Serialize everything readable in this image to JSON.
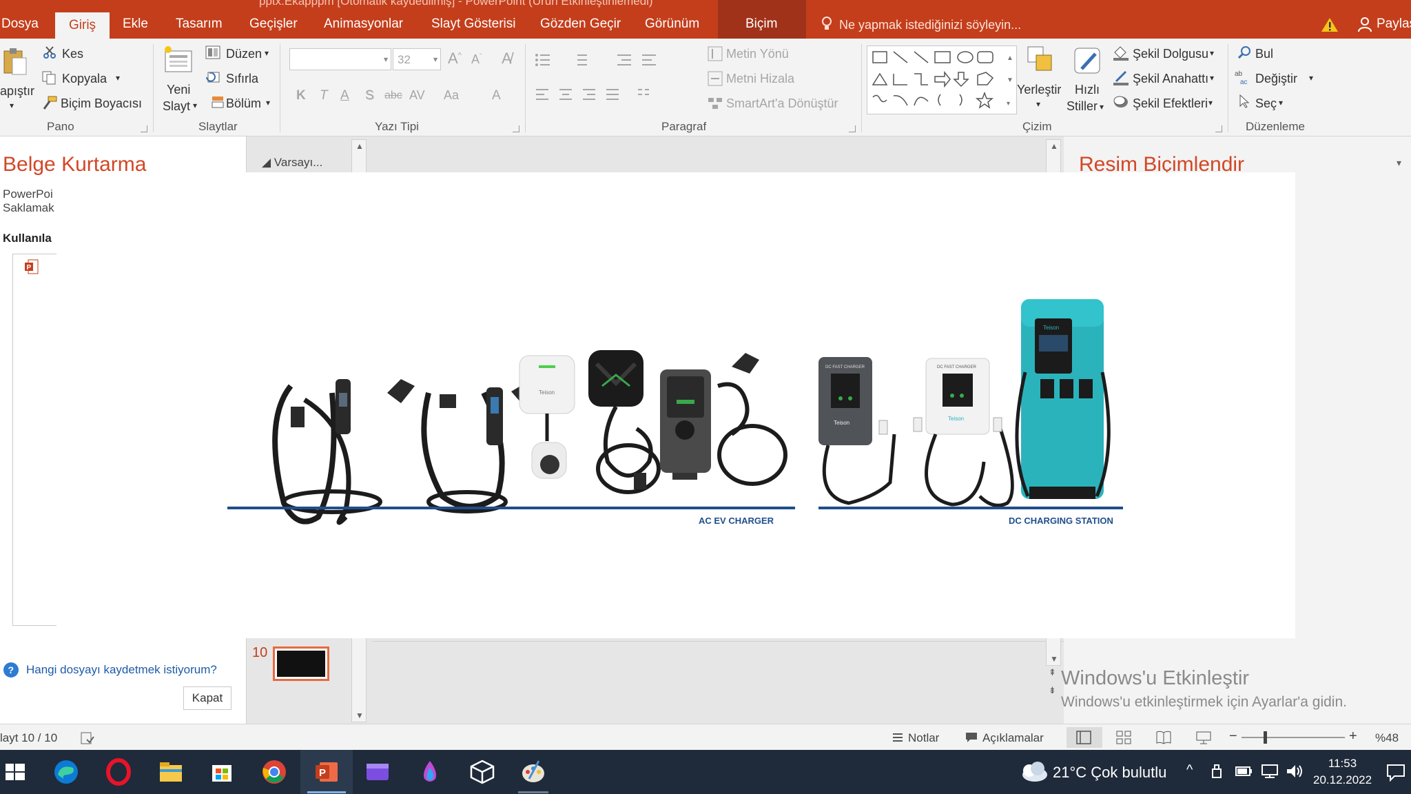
{
  "window": {
    "title_fragment": "pptx.Ekapppm [Otomatik kaydedilmiş] - PowerPoint (Ürün Etkinleştirilemedi)"
  },
  "tabs": [
    {
      "label": "Dosya"
    },
    {
      "label": "Giriş"
    },
    {
      "label": "Ekle"
    },
    {
      "label": "Tasarım"
    },
    {
      "label": "Geçişler"
    },
    {
      "label": "Animasyonlar"
    },
    {
      "label": "Slayt Gösterisi"
    },
    {
      "label": "Gözden Geçir"
    },
    {
      "label": "Görünüm"
    },
    {
      "label": "Biçim"
    }
  ],
  "tell_me": "Ne yapmak istediğinizi söyleyin...",
  "share": "Paylaş",
  "ribbon": {
    "clipboard": {
      "paste": "apıştır",
      "cut": "Kes",
      "copy": "Kopyala",
      "format_painter": "Biçim Boyacısı",
      "group": "Pano"
    },
    "slides": {
      "new_slide_line1": "Yeni",
      "new_slide_line2": "Slayt",
      "layout": "Düzen",
      "reset": "Sıfırla",
      "section": "Bölüm",
      "group": "Slaytlar"
    },
    "font": {
      "font_name": "",
      "font_size": "32",
      "group": "Yazı Tipi",
      "bold": "K",
      "italic": "T",
      "underline": "A",
      "shadow": "S",
      "strike": "abc",
      "spacing": "AV",
      "case": "Aa",
      "color": "A"
    },
    "paragraph": {
      "text_direction": "Metin Yönü",
      "align_text": "Metni Hizala",
      "smartart": "SmartArt'a Dönüştür",
      "group": "Paragraf"
    },
    "drawing": {
      "arrange": "Yerleştir",
      "quick_styles_line1": "Hızlı",
      "quick_styles_line2": "Stiller",
      "shape_fill": "Şekil Dolgusu",
      "shape_outline": "Şekil Anahattı",
      "shape_effects": "Şekil Efektleri",
      "group": "Çizim"
    },
    "editing": {
      "find": "Bul",
      "replace": "Değiştir",
      "select": "Seç",
      "group": "Düzenleme"
    }
  },
  "recovery_pane": {
    "title": "Belge Kurtarma",
    "desc_line1": "PowerPoi",
    "desc_line2": "Saklamak",
    "available": "Kullanıla",
    "help_link": "Hangi dosyayı kaydetmek istiyorum?",
    "close_button": "Kapat"
  },
  "thumbnail_pane": {
    "section": "Varsayı...",
    "slide_number": "10"
  },
  "format_pane": {
    "title": "Resim Biçimlendir"
  },
  "watermark": {
    "line1": "Windows'u Etkinleştir",
    "line2": "Windows'u etkinleştirmek için Ayarlar'a gidin."
  },
  "picture": {
    "ac_label": "AC EV CHARGER",
    "dc_label": "DC CHARGING STATION",
    "brand": "Teison",
    "dc_tag": "DC FAST CHARGER",
    "accent": "#1f4e8c",
    "station_color": "#2bb3bc"
  },
  "status_bar": {
    "slide_info": "layt 10 / 10",
    "notes": "Notlar",
    "comments": "Açıklamalar",
    "zoom": "%48"
  },
  "taskbar": {
    "apps": [
      "windows-start",
      "edge",
      "opera",
      "file-explorer",
      "store",
      "chrome",
      "powerpoint",
      "clipchamp",
      "paint3d",
      "3d-viewer",
      "paint"
    ],
    "weather": "21°C  Çok bulutlu",
    "time": "11:53",
    "date": "20.12.2022"
  }
}
